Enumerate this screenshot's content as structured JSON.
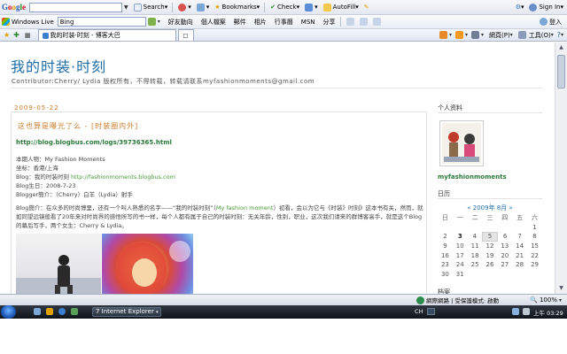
{
  "google_toolbar": {
    "logo": [
      "G",
      "o",
      "o",
      "g",
      "l",
      "e"
    ],
    "search_label": "Search",
    "bookmarks_label": "Bookmarks",
    "check_label": "Check",
    "autofill_label": "AutoFill",
    "signin_label": "Sign In"
  },
  "live_toolbar": {
    "brand": "Windows Live",
    "search_value": "Bing",
    "items": [
      "好友動向",
      "個人檔案",
      "郵件",
      "相片",
      "行事曆",
      "MSN",
      "分享"
    ],
    "login_label": "登入"
  },
  "tab_bar": {
    "tab_title": "我的时装·时刻 - 博客大巴",
    "page_menu": "網頁(P)",
    "tools_menu": "工具(O)"
  },
  "blog": {
    "title": "我的时装·时刻",
    "description": "Contributor:Cherry/ Lydia 版权所有，不得转载，转载请联系myfashionmoments@gmail.com",
    "post": {
      "date": "2009-05-22",
      "title": "这也算是曝光了么 - [时装圈内外]",
      "link": "http://blog.blogbus.com/logs/39736365.html",
      "lines": [
        {
          "text": "本期人物：My Fashion Moments",
          "extra": ""
        },
        {
          "text": "坐标：香港/上海",
          "extra": ""
        },
        {
          "text": "Blog：我的时装时刻   ",
          "extra": "http://fashionmoments.blogbus.com"
        },
        {
          "text": "Blog生日：2008-7-23",
          "extra": ""
        },
        {
          "text": "Blogger簡介：（Cherry）白羊（Lydia）射手",
          "extra": ""
        }
      ],
      "intro_a": "Blog簡介：在众多的时尚博里，还有一个叫人熟悉的名字——“我的时装时刻”（",
      "intro_highlight": "My fashion moment",
      "intro_b": "）初看，会以为它与《时装》时刻》这本书有关，然而，就如同望远镜般看了20年来对时尚界的感悟所写的书一样，每个人都有属于自己的时装时刻：无关年龄，性别，职业，这次我们请来的群博客高手，就是这个Blog的幕后写手，两个女生：Cherry & Lydia。"
    }
  },
  "sidebar": {
    "profile_title": "个人资料",
    "profile_name": "myfashionmoments",
    "calendar_title": "日历",
    "calendar_nav_prev": "«",
    "calendar_month": "2009年 8月",
    "calendar_nav_next": "»",
    "weekdays": [
      "日",
      "一",
      "二",
      "三",
      "四",
      "五",
      "六"
    ],
    "weeks": [
      [
        "",
        "",
        "",
        "",
        "",
        "",
        "1"
      ],
      [
        "2",
        "3",
        "4",
        "5",
        "6",
        "7",
        "8"
      ],
      [
        "9",
        "10",
        "11",
        "12",
        "13",
        "14",
        "15"
      ],
      [
        "16",
        "17",
        "18",
        "19",
        "20",
        "21",
        "22"
      ],
      [
        "23",
        "24",
        "25",
        "26",
        "27",
        "28",
        "29"
      ],
      [
        "30",
        "31",
        "",
        "",
        "",
        "",
        ""
      ]
    ],
    "next_section": "档案"
  },
  "status_bar": {
    "zone": "網際網路 | 受保護模式: 啟動",
    "zoom": "100%"
  },
  "taskbar": {
    "ie_button": "7 Internet Explorer",
    "lang": "CH",
    "clock": "上午 03:29"
  }
}
